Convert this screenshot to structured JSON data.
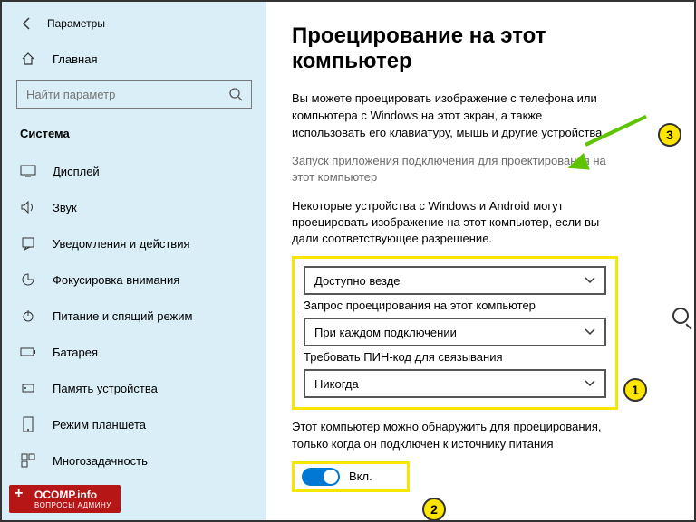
{
  "header": {
    "title": "Параметры"
  },
  "sidebar": {
    "home": "Главная",
    "search_placeholder": "Найти параметр",
    "category": "Система",
    "items": [
      {
        "label": "Дисплей"
      },
      {
        "label": "Звук"
      },
      {
        "label": "Уведомления и действия"
      },
      {
        "label": "Фокусировка внимания"
      },
      {
        "label": "Питание и спящий режим"
      },
      {
        "label": "Батарея"
      },
      {
        "label": "Память устройства"
      },
      {
        "label": "Режим планшета"
      },
      {
        "label": "Многозадачность"
      }
    ]
  },
  "main": {
    "title": "Проецирование на этот компьютер",
    "desc": "Вы можете проецировать изображение с телефона или компьютера с Windows на этот экран, а также использовать его клавиатуру, мышь и другие устройства.",
    "link": "Запуск приложения подключения для проектирования на этот компьютер",
    "sub": "Некоторые устройства с Windows и Android могут проецировать изображение на этот компьютер, если вы дали соответствующее разрешение.",
    "select1": {
      "value": "Доступно везде"
    },
    "label2": "Запрос проецирования на этот компьютер",
    "select2": {
      "value": "При каждом подключении"
    },
    "label3": "Требовать ПИН-код для связывания",
    "select3": {
      "value": "Никогда"
    },
    "discover": "Этот компьютер можно обнаружить для проецирования, только когда он подключен к источнику питания",
    "toggle_label": "Вкл."
  },
  "callouts": {
    "c1": "1",
    "c2": "2",
    "c3": "3"
  },
  "watermark": {
    "brand": "OCOMP.info",
    "tag": "ВОПРОСЫ АДМИНУ"
  }
}
